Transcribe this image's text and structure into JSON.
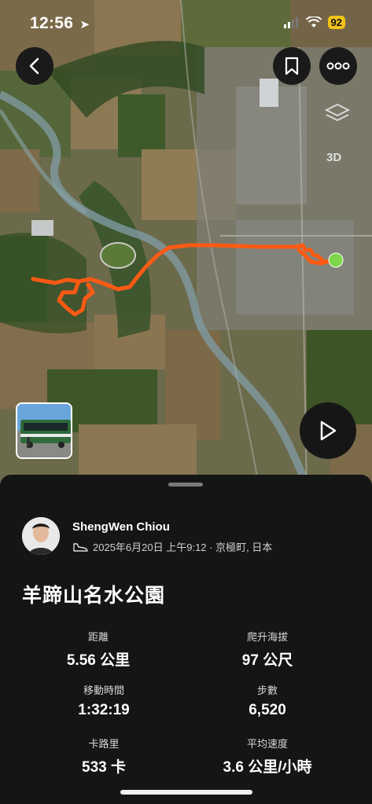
{
  "status_bar": {
    "time": "12:56",
    "battery": "92"
  },
  "map": {
    "view_mode_label": "3D",
    "route_color": "#ff5a14",
    "start_marker_color": "#7ed64b"
  },
  "activity": {
    "user_name": "ShengWen Chiou",
    "meta": "2025年6月20日 上午9:12 · 京極町, 日本",
    "title": "羊蹄山名水公園"
  },
  "stats": [
    {
      "label": "距離",
      "value": "5.56 公里"
    },
    {
      "label": "爬升海拔",
      "value": "97 公尺"
    },
    {
      "label": "移動時間",
      "value": "1:32:19"
    },
    {
      "label": "步數",
      "value": "6,520"
    },
    {
      "label": "卡路里",
      "value": "533 卡"
    },
    {
      "label": "平均速度",
      "value": "3.6 公里/小時"
    }
  ]
}
